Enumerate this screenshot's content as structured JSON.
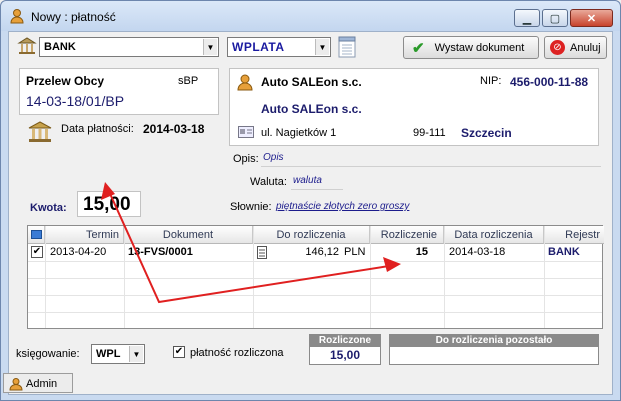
{
  "window": {
    "title": "Nowy : płatność"
  },
  "toolbar": {
    "account_value": "BANK",
    "type_value": "WPLATA",
    "issue_label": "Wystaw dokument",
    "cancel_label": "Anuluj"
  },
  "doc": {
    "type": "Przelew Obcy",
    "code": "sBP",
    "number": "14-03-18/01/BP",
    "payment_date_label": "Data płatności:",
    "payment_date": "2014-03-18"
  },
  "contractor": {
    "name": "Auto SALEon s.c.",
    "nip_label": "NIP:",
    "nip": "456-000-11-88",
    "name2": "Auto SALEon s.c.",
    "street": "ul. Nagietków 1",
    "postal": "99-111",
    "city": "Szczecin"
  },
  "details": {
    "opis_label": "Opis:",
    "opis_value": "Opis",
    "waluta_label": "Waluta:",
    "waluta_value": "waluta",
    "slownie_label": "Słownie:",
    "slownie_value": "piętnaście złotych zero groszy"
  },
  "amount": {
    "label": "Kwota:",
    "value": "15,00"
  },
  "grid": {
    "columns": [
      "Termin",
      "Dokument",
      "Do rozliczenia",
      "Rozliczenie",
      "Data rozliczenia",
      "Rejestr"
    ],
    "rows": [
      {
        "termin": "2013-04-20",
        "dokument": "13-FVS/0001",
        "do_rozliczenia": "146,12",
        "currency": "PLN",
        "rozliczenie": "15",
        "data_rozliczenia": "2014-03-18",
        "rejestr": "BANK",
        "checked": true
      }
    ]
  },
  "bottom": {
    "ksiegowanie_label": "księgowanie:",
    "ksiegowanie_value": "WPL",
    "platnosc_label": "płatność rozliczona",
    "rozliczone_label": "Rozliczone",
    "rozliczone_value": "15,00",
    "pozostalo_label": "Do rozliczenia pozostało",
    "pozostalo_value": ""
  },
  "status": {
    "user": "Admin"
  },
  "colors": {
    "accent_red": "#e02020",
    "navy_text": "#1c1c6c",
    "header_box": "#8a8a8a"
  }
}
